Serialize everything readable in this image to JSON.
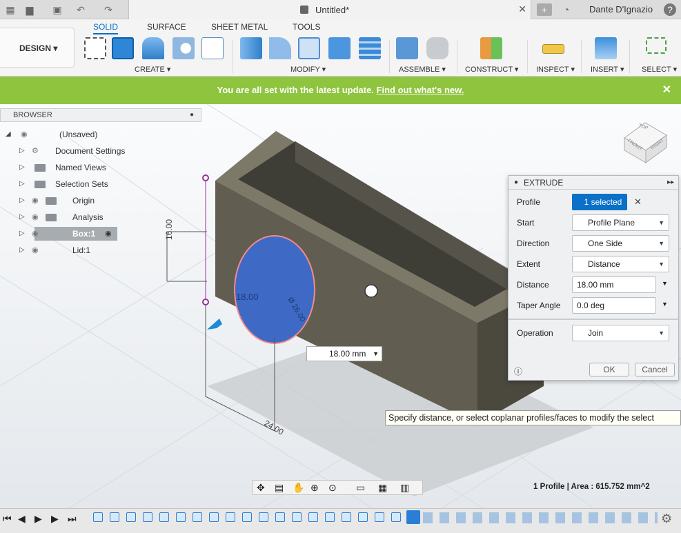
{
  "titlebar": {
    "document_title": "Untitled*",
    "user": "Dante D'Ignazio"
  },
  "ribbon": {
    "workspace": "DESIGN",
    "tabs": [
      "SOLID",
      "SURFACE",
      "SHEET METAL",
      "TOOLS"
    ],
    "groups": [
      "CREATE",
      "MODIFY",
      "ASSEMBLE",
      "CONSTRUCT",
      "INSPECT",
      "INSERT",
      "SELECT"
    ]
  },
  "notice": {
    "text": "You are all set with the latest update.",
    "link": "Find out what's new."
  },
  "browser": {
    "title": "BROWSER",
    "items": [
      "(Unsaved)",
      "Document Settings",
      "Named Views",
      "Selection Sets",
      "Origin",
      "Analysis",
      "Box:1",
      "Lid:1"
    ]
  },
  "extrude": {
    "title": "EXTRUDE",
    "rows": [
      {
        "label": "Profile",
        "value": "1 selected"
      },
      {
        "label": "Start",
        "value": "Profile Plane"
      },
      {
        "label": "Direction",
        "value": "One Side"
      },
      {
        "label": "Extent",
        "value": "Distance"
      },
      {
        "label": "Distance",
        "value": "18.00 mm"
      },
      {
        "label": "Taper Angle",
        "value": "0.0 deg"
      },
      {
        "label": "Operation",
        "value": "Join"
      }
    ],
    "ok": "OK",
    "cancel": "Cancel"
  },
  "viewport": {
    "dim_input": "18.00 mm",
    "dim_16": "16.00",
    "dim_18": "18.00",
    "dim_24": "24.00",
    "dia": "Ø 26.00",
    "tooltip": "Specify distance, or select coplanar profiles/faces to modify the select",
    "viewcube_top": "TOP",
    "viewcube_front": "FRONT",
    "viewcube_right": "RIGHT"
  },
  "status": {
    "text": "1 Profile | Area : 615.752 mm^2"
  },
  "colors": {
    "accent": "#0a70c8",
    "notice": "#8fc43f",
    "body": "#615d50",
    "profile": "#3e69c4"
  }
}
